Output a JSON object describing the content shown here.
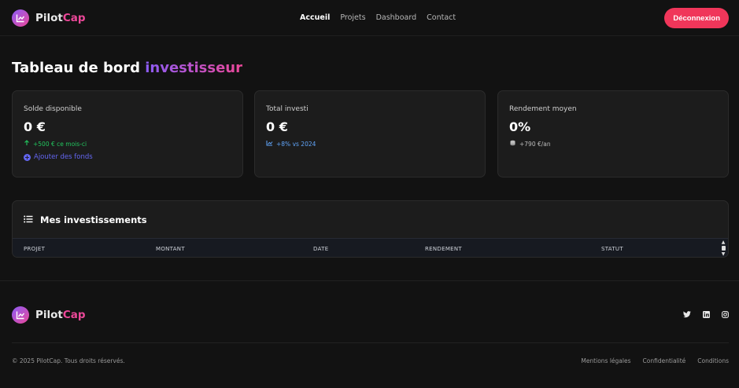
{
  "brand": {
    "name_main": "Pilot",
    "name_accent": "Cap"
  },
  "nav": {
    "items": [
      "Accueil",
      "Projets",
      "Dashboard",
      "Contact"
    ],
    "active": "Accueil"
  },
  "header": {
    "logout_label": "Déconnexion"
  },
  "page": {
    "title_main": "Tableau de bord",
    "title_highlight": "investisseur"
  },
  "cards": [
    {
      "label": "Solde disponible",
      "value": "0 €",
      "sub": "+500 € ce mois-ci",
      "action": "Ajouter des fonds"
    },
    {
      "label": "Total investi",
      "value": "0 €",
      "sub": "+8% vs 2024"
    },
    {
      "label": "Rendement moyen",
      "value": "0%",
      "sub": "+790 €/an"
    }
  ],
  "investments": {
    "title": "Mes investissements",
    "columns": [
      "PROJET",
      "MONTANT",
      "DATE",
      "RENDEMENT",
      "STATUT"
    ]
  },
  "footer": {
    "copyright": "© 2025 PilotCap. Tous droits réservés.",
    "links": [
      "Mentions légales",
      "Confidentialité",
      "Conditions"
    ],
    "socials": [
      "twitter-icon",
      "linkedin-icon",
      "instagram-icon"
    ]
  },
  "colors": {
    "accent_purple": "#8b5cf6",
    "accent_pink": "#ec4899",
    "logout": "#f0365a",
    "green": "#22c55e",
    "blue": "#60a5fa",
    "indigo": "#6366f1"
  }
}
